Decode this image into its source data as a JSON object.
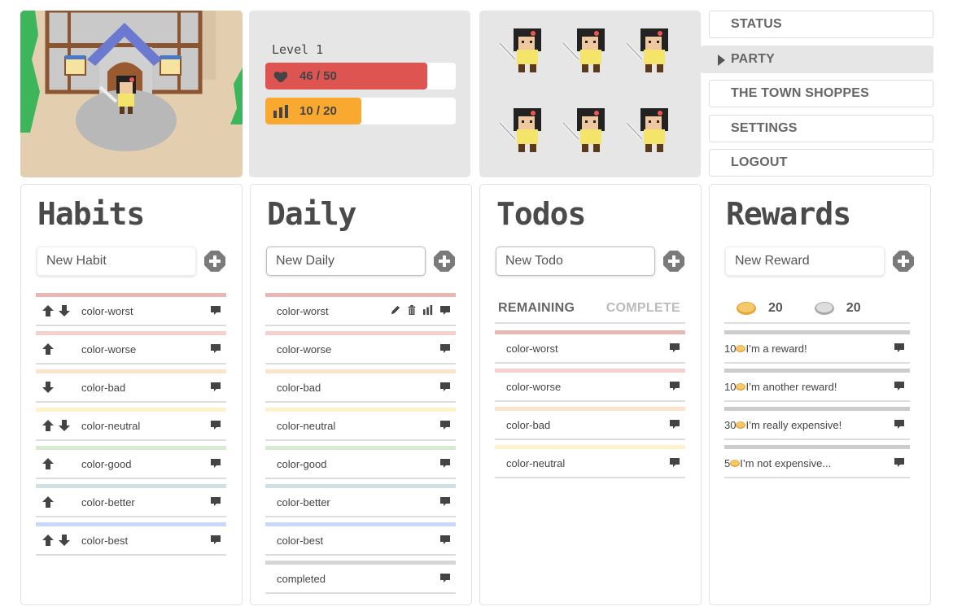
{
  "avatar": {
    "scene": "house-with-avatar"
  },
  "stats": {
    "level_label": "Level 1",
    "hp": {
      "icon": "heart-icon",
      "text": "46 / 50",
      "current": 46,
      "max": 50,
      "color": "#de5451"
    },
    "xp": {
      "icon": "bars-icon",
      "text": "10 / 20",
      "current": 10,
      "max": 20,
      "color": "#f9a830"
    }
  },
  "party": {
    "member_count": 6
  },
  "nav": {
    "items": [
      {
        "label": "STATUS",
        "active": false
      },
      {
        "label": "PARTY",
        "active": true
      },
      {
        "label": "THE TOWN SHOPPES",
        "active": false
      },
      {
        "label": "SETTINGS",
        "active": false
      },
      {
        "label": "LOGOUT",
        "active": false
      }
    ]
  },
  "colors": {
    "worst": "#e6b8b1",
    "worse": "#f6cfcf",
    "bad": "#fbe3cc",
    "neutral": "#fdf2cc",
    "good": "#d9ead3",
    "better": "#d0e0e3",
    "best": "#c9daf8",
    "completed": "#d5d5d5",
    "reward": "#cccccc"
  },
  "habits": {
    "title": "Habits",
    "input_placeholder": "New Habit",
    "items": [
      {
        "label": "color-worst",
        "color": "worst",
        "up": true,
        "down": true
      },
      {
        "label": "color-worse",
        "color": "worse",
        "up": true,
        "down": false
      },
      {
        "label": "color-bad",
        "color": "bad",
        "up": false,
        "down": true
      },
      {
        "label": "color-neutral",
        "color": "neutral",
        "up": true,
        "down": true
      },
      {
        "label": "color-good",
        "color": "good",
        "up": true,
        "down": false
      },
      {
        "label": "color-better",
        "color": "better",
        "up": true,
        "down": false
      },
      {
        "label": "color-best",
        "color": "best",
        "up": true,
        "down": true
      }
    ]
  },
  "daily": {
    "title": "Daily",
    "input_placeholder": "New Daily",
    "items": [
      {
        "label": "color-worst",
        "color": "worst",
        "hover": true
      },
      {
        "label": "color-worse",
        "color": "worse"
      },
      {
        "label": "color-bad",
        "color": "bad"
      },
      {
        "label": "color-neutral",
        "color": "neutral"
      },
      {
        "label": "color-good",
        "color": "good"
      },
      {
        "label": "color-better",
        "color": "better"
      },
      {
        "label": "color-best",
        "color": "best"
      },
      {
        "label": "completed",
        "color": "completed"
      }
    ]
  },
  "todos": {
    "title": "Todos",
    "input_placeholder": "New Todo",
    "tabs": [
      {
        "label": "REMAINING",
        "active": true
      },
      {
        "label": "COMPLETE",
        "active": false
      }
    ],
    "items": [
      {
        "label": "color-worst",
        "color": "worst"
      },
      {
        "label": "color-worse",
        "color": "worse"
      },
      {
        "label": "color-bad",
        "color": "bad"
      },
      {
        "label": "color-neutral",
        "color": "neutral"
      }
    ]
  },
  "rewards": {
    "title": "Rewards",
    "input_placeholder": "New Reward",
    "gold": "20",
    "silver": "20",
    "items": [
      {
        "price": "10",
        "label": "I’m a reward!"
      },
      {
        "price": "10",
        "label": "I’m another reward!"
      },
      {
        "price": "30",
        "label": "I’m really expensive!"
      },
      {
        "price": "5",
        "label": "I’m not expensive..."
      }
    ]
  }
}
